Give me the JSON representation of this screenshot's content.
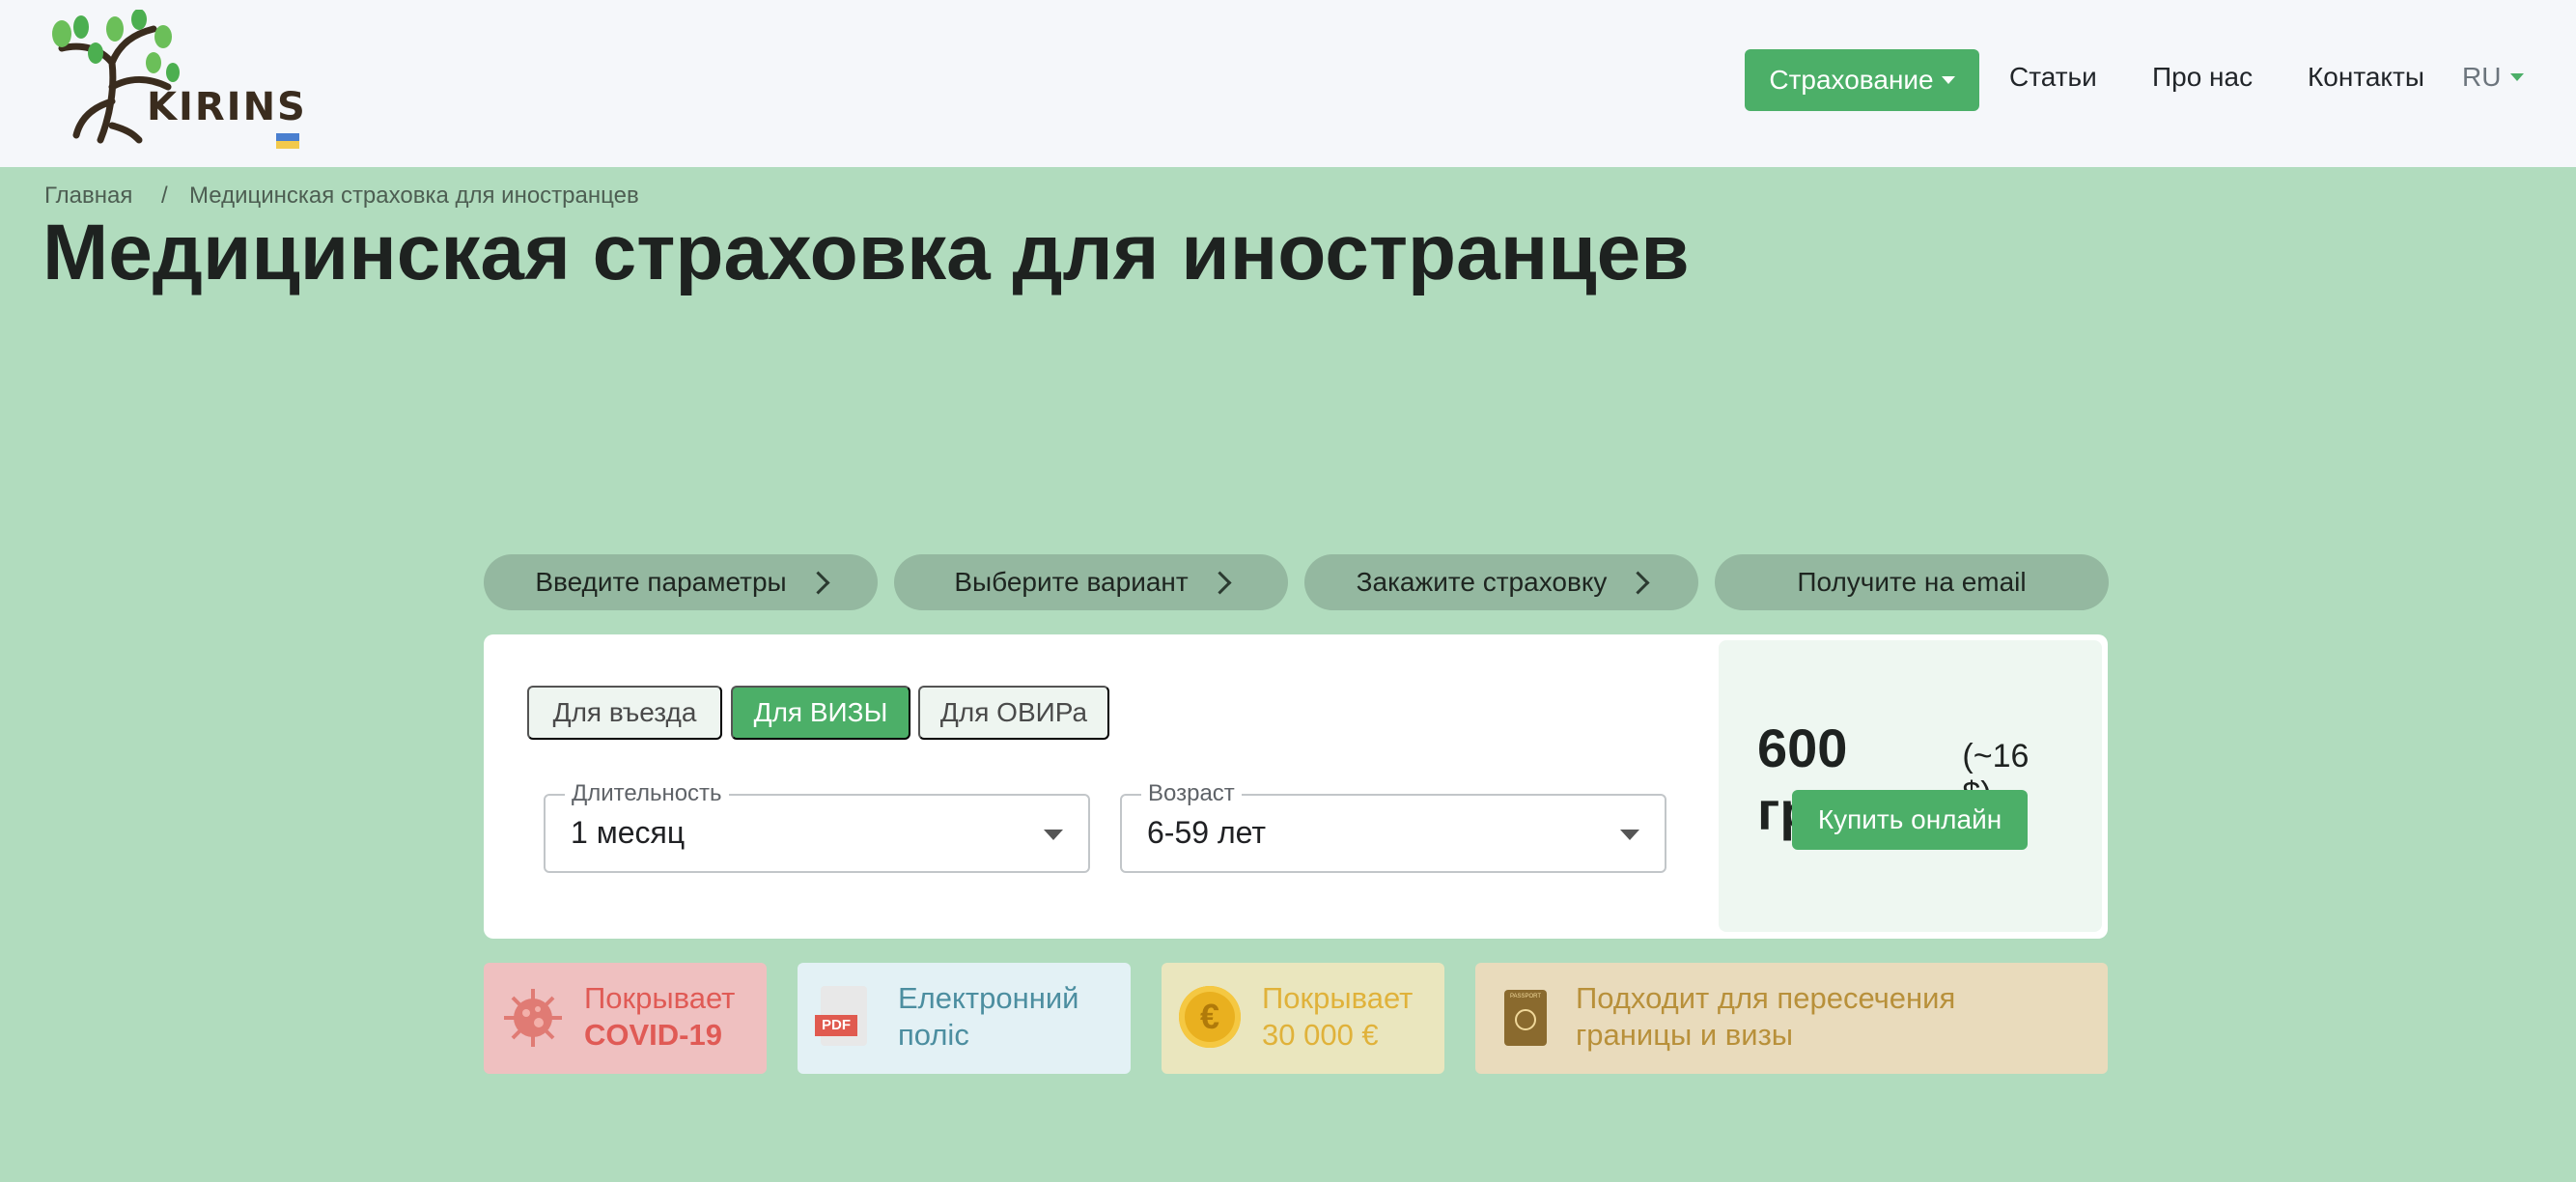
{
  "header": {
    "logo_text": "KIRINS",
    "nav": {
      "insurance_label": "Страхование",
      "articles_label": "Статьи",
      "about_label": "Про нас",
      "contacts_label": "Контакты",
      "language": "RU"
    }
  },
  "breadcrumb": {
    "home": "Главная",
    "separator": "/",
    "current": "Медицинская страховка для иностранцев"
  },
  "page_title": "Медицинская страховка для иностранцев",
  "steps": [
    {
      "label": "Введите параметры"
    },
    {
      "label": "Выберите вариант"
    },
    {
      "label": "Закажите страховку"
    },
    {
      "label": "Получите на email"
    }
  ],
  "form": {
    "tabs": [
      {
        "label": "Для въезда",
        "active": false
      },
      {
        "label": "Для ВИЗЫ",
        "active": true
      },
      {
        "label": "Для ОВИРа",
        "active": false
      }
    ],
    "duration": {
      "label": "Длительность",
      "value": "1 месяц"
    },
    "age": {
      "label": "Возраст",
      "value": "6-59 лет"
    }
  },
  "price": {
    "amount": "600 грн",
    "usd": "(~16 $)",
    "buy_label": "Купить онлайн"
  },
  "features": [
    {
      "line1": "Покрывает",
      "line2": "COVID-19",
      "icon": "virus-icon"
    },
    {
      "line1": "Електронний",
      "line2": "поліс",
      "icon": "pdf-icon",
      "icon_text": "PDF"
    },
    {
      "line1": "Покрывает",
      "line2": "30 000 €",
      "icon": "euro-coin-icon",
      "icon_text": "€"
    },
    {
      "line1": "Подходит для пересечения",
      "line2": "границы и визы",
      "icon": "passport-icon",
      "icon_text": "PASSPORT"
    }
  ],
  "colors": {
    "accent": "#4caf68",
    "page_background": "#b1dcbe",
    "header_background": "#f5f7fa",
    "step_background": "#94b8a0"
  }
}
